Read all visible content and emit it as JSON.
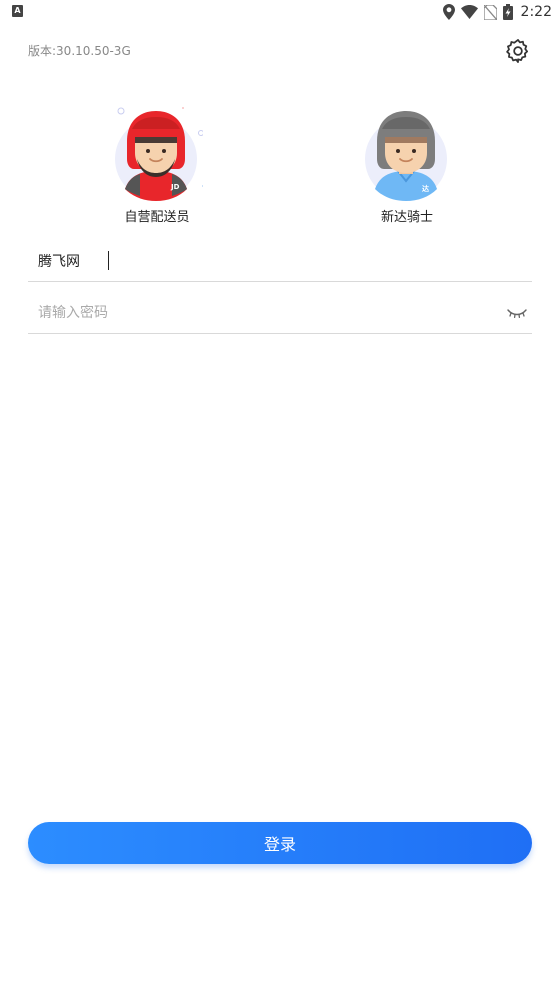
{
  "status_bar": {
    "app_icon_letter": "A",
    "time": "2:22"
  },
  "header": {
    "version": "版本:30.10.50-3G"
  },
  "roles": [
    {
      "label": "自营配送员",
      "helmet_color": "#e8262b",
      "badge": "JD"
    },
    {
      "label": "新达骑士",
      "helmet_color": "#7d7d7d",
      "badge": "达"
    }
  ],
  "login": {
    "username_value": "腾飞网",
    "password_placeholder": "请输入密码",
    "button_label": "登录"
  },
  "colors": {
    "primary": "#1f7bfa",
    "jd_red": "#e8262b",
    "rider_blue": "#6fb8f5"
  }
}
